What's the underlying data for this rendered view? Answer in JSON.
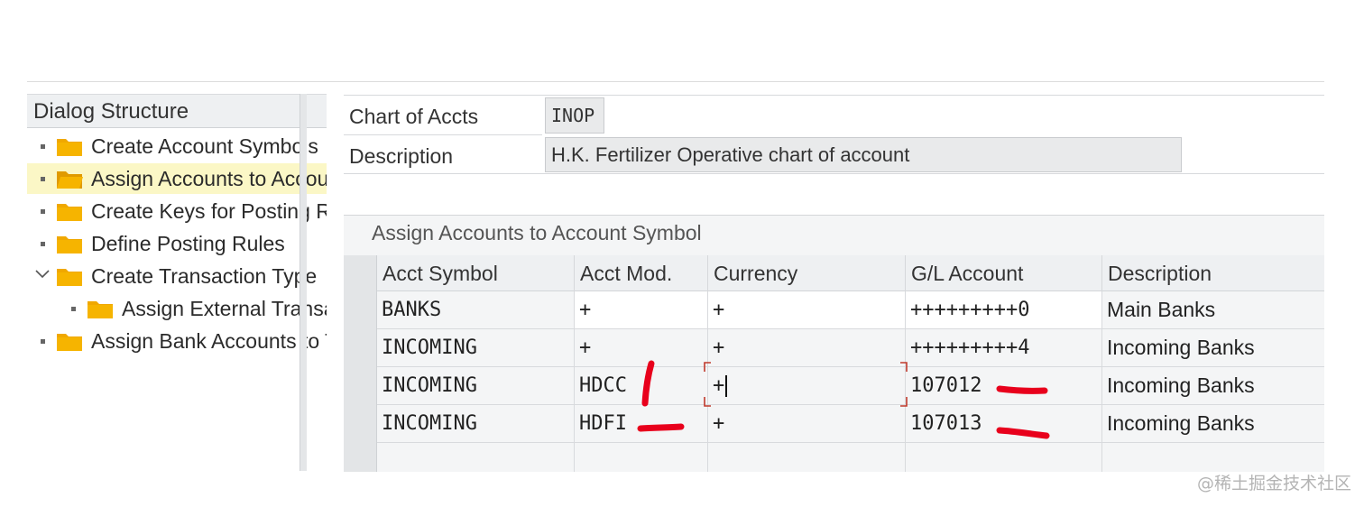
{
  "dialog": {
    "header": "Dialog Structure",
    "items": [
      {
        "label": "Create Account Symbols",
        "level": 0,
        "expander": "bullet",
        "icon": "folder-closed-icon"
      },
      {
        "label": "Assign Accounts to Account Symbol",
        "level": 0,
        "expander": "bullet",
        "icon": "folder-open-icon",
        "selected": true
      },
      {
        "label": "Create Keys for Posting Rules",
        "level": 0,
        "expander": "bullet",
        "icon": "folder-closed-icon"
      },
      {
        "label": "Define Posting Rules",
        "level": 0,
        "expander": "bullet",
        "icon": "folder-closed-icon"
      },
      {
        "label": "Create Transaction Type",
        "level": 0,
        "expander": "chevron-down",
        "icon": "folder-closed-icon"
      },
      {
        "label": "Assign External Transaction Types to Posting Rules",
        "level": 1,
        "expander": "bullet",
        "icon": "folder-closed-icon"
      },
      {
        "label": "Assign Bank Accounts to Transaction Types",
        "level": 0,
        "expander": "bullet",
        "icon": "folder-closed-icon"
      }
    ]
  },
  "header_fields": {
    "chart_label": "Chart of Accts",
    "chart_value": "INOP",
    "desc_label": "Description",
    "desc_value": "H.K. Fertilizer Operative chart of account"
  },
  "table": {
    "title": "Assign Accounts to Account Symbol",
    "columns": [
      "Acct Symbol",
      "Acct Mod.",
      "Currency",
      "G/L Account",
      "Description"
    ],
    "rows": [
      [
        "BANKS",
        "+",
        "+",
        "+++++++++0",
        "Main Banks"
      ],
      [
        "INCOMING",
        "+",
        "+",
        "+++++++++4",
        "Incoming Banks"
      ],
      [
        "INCOMING",
        "HDCC",
        "+",
        "107012",
        "Incoming Banks"
      ],
      [
        "INCOMING",
        "HDFI",
        "+",
        "107013",
        "Incoming Banks"
      ]
    ]
  },
  "colors": {
    "accent_folder": "#f0a800",
    "selection": "#fbf7c6",
    "annotation": "#e8001c"
  },
  "watermark": "@稀土掘金技术社区"
}
